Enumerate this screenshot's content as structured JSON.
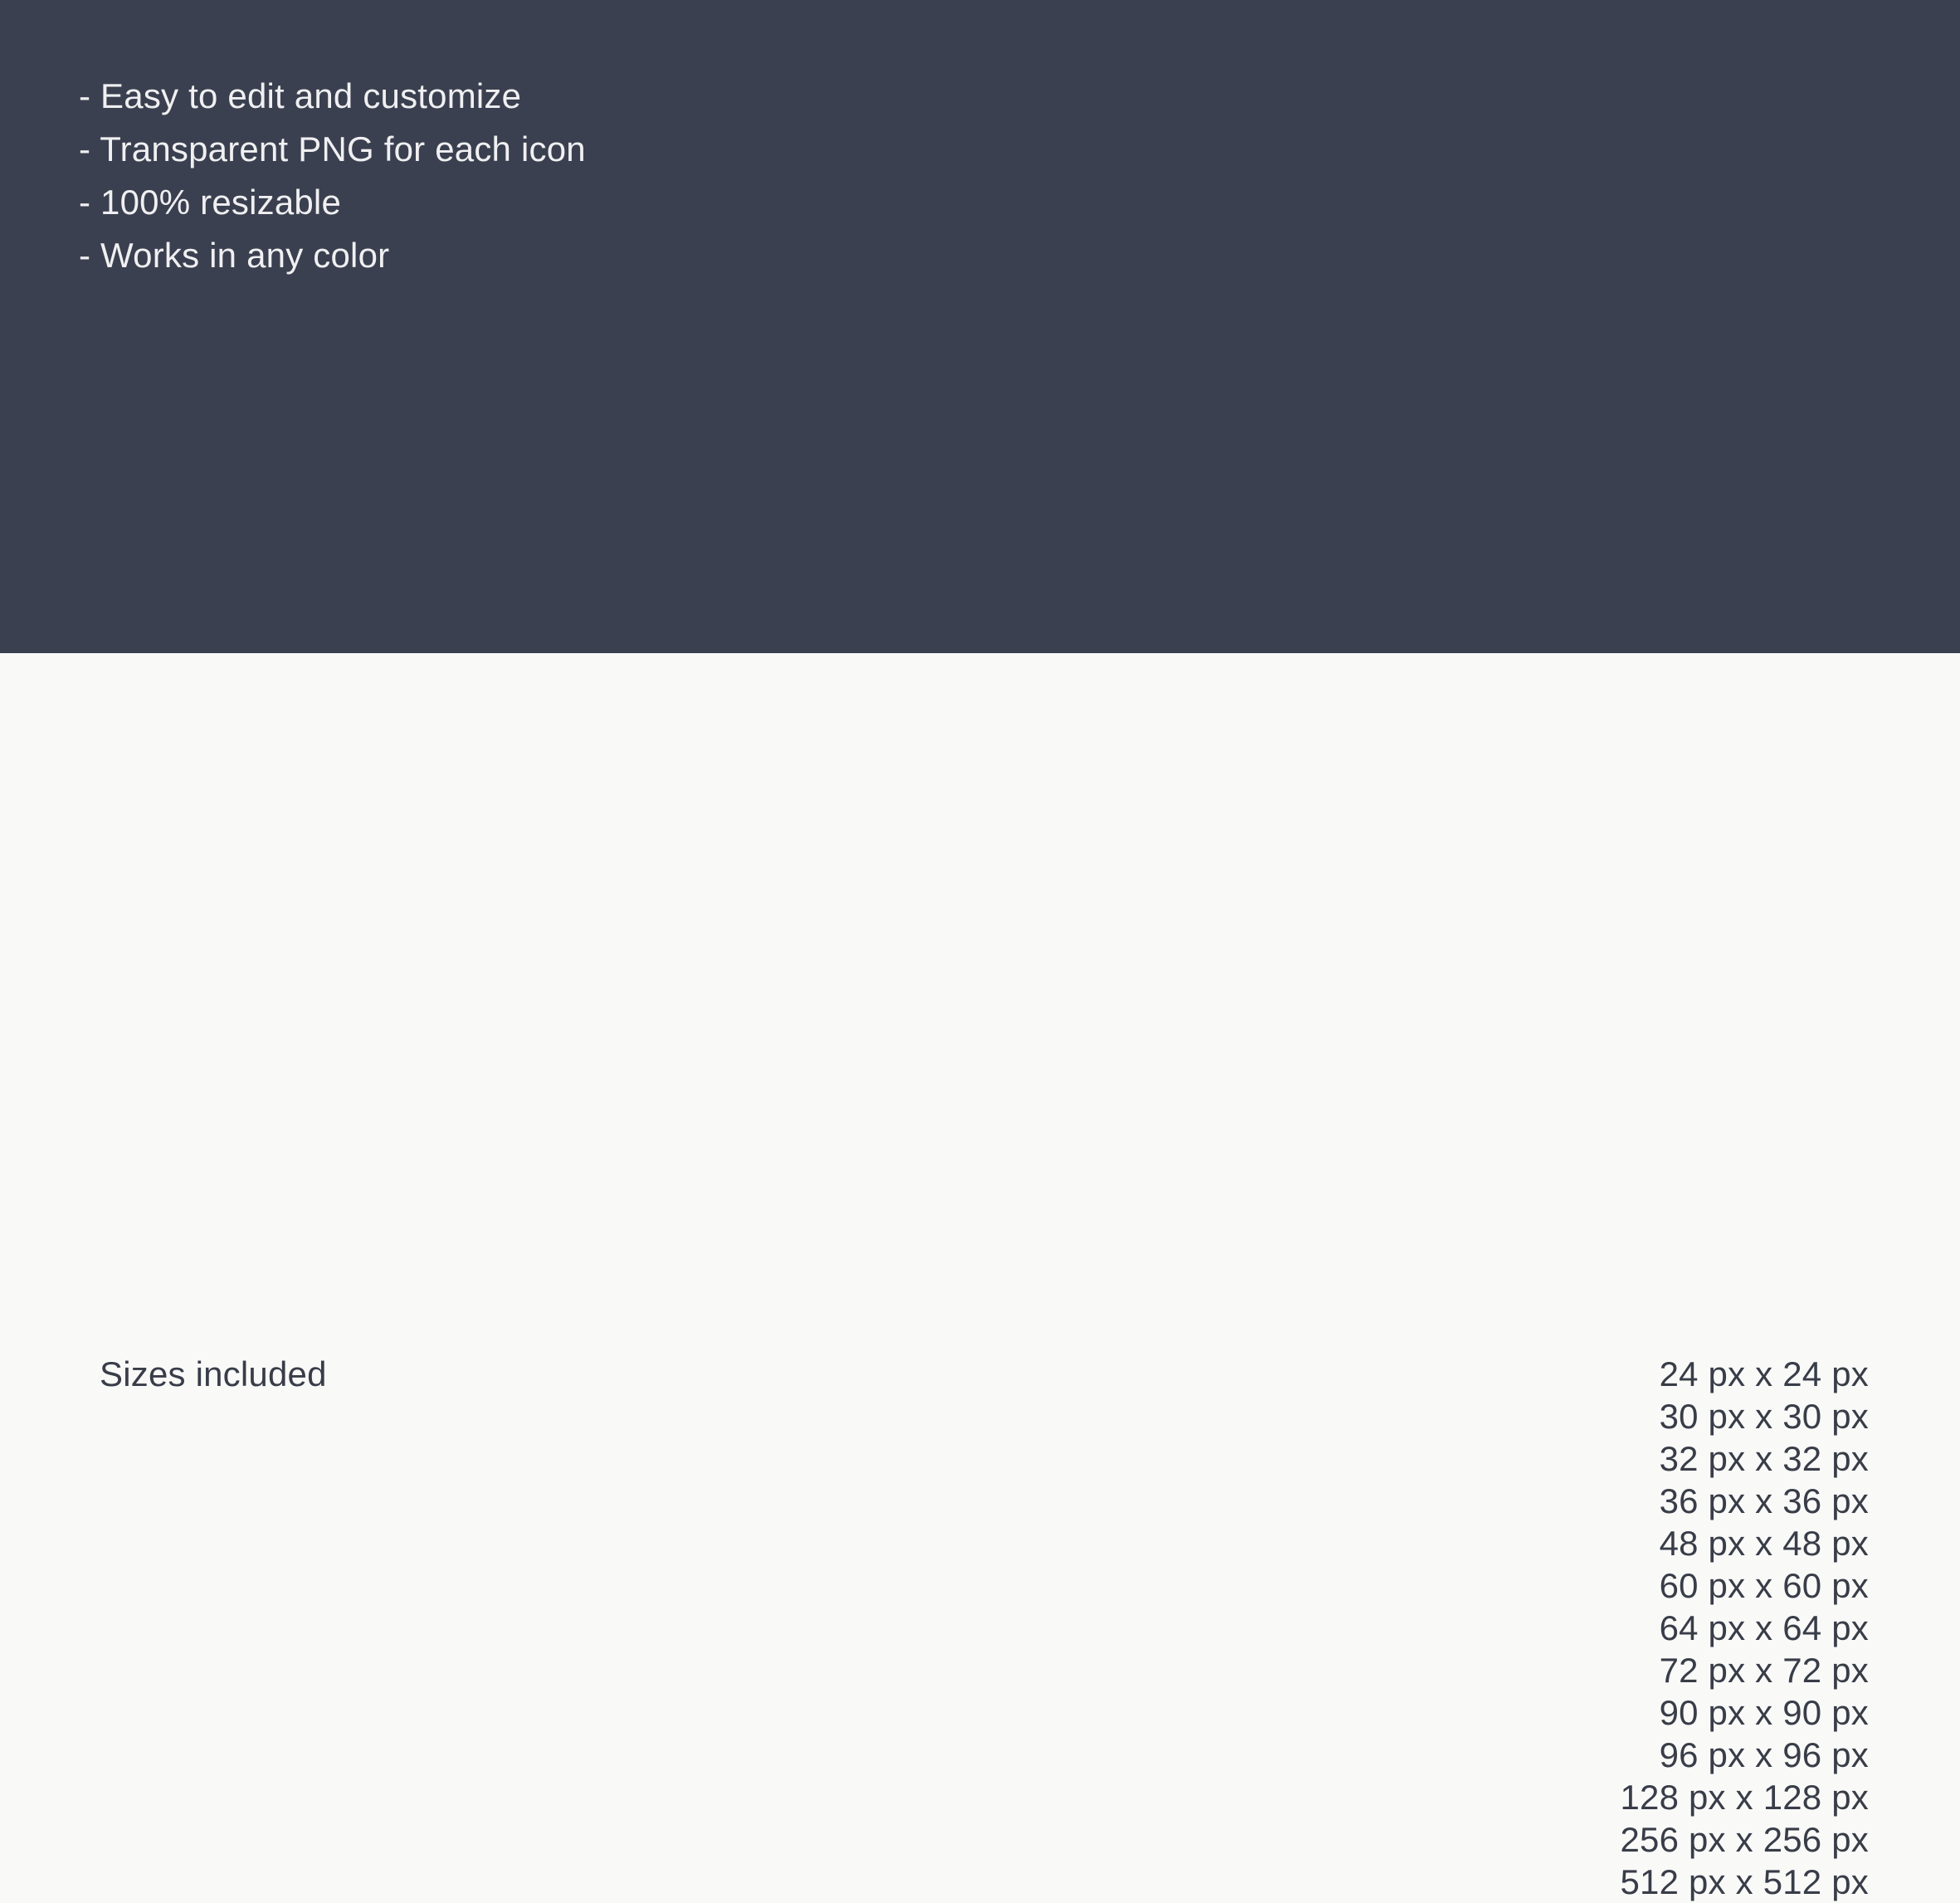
{
  "hero": {
    "background_color": "#3b4050",
    "text_color": "#f0f0f2",
    "features": [
      "- Easy to edit and customize",
      "- Transparent PNG for each icon",
      "- 100% resizable",
      "- Works in any color"
    ]
  },
  "sizes_section": {
    "background_color": "#f9f9f8",
    "text_color": "#383d48",
    "heading": "Sizes included",
    "sizes": [
      "24 px x 24 px",
      "30 px x 30 px",
      "32 px x 32 px",
      "36 px x 36 px",
      "48 px x 48 px",
      "60 px x 60 px",
      "64 px x 64 px",
      "72 px x 72 px",
      "90 px x 90 px",
      "96 px x 96 px",
      "128 px x 128 px",
      "256 px x 256 px",
      "512 px x 512 px"
    ]
  }
}
